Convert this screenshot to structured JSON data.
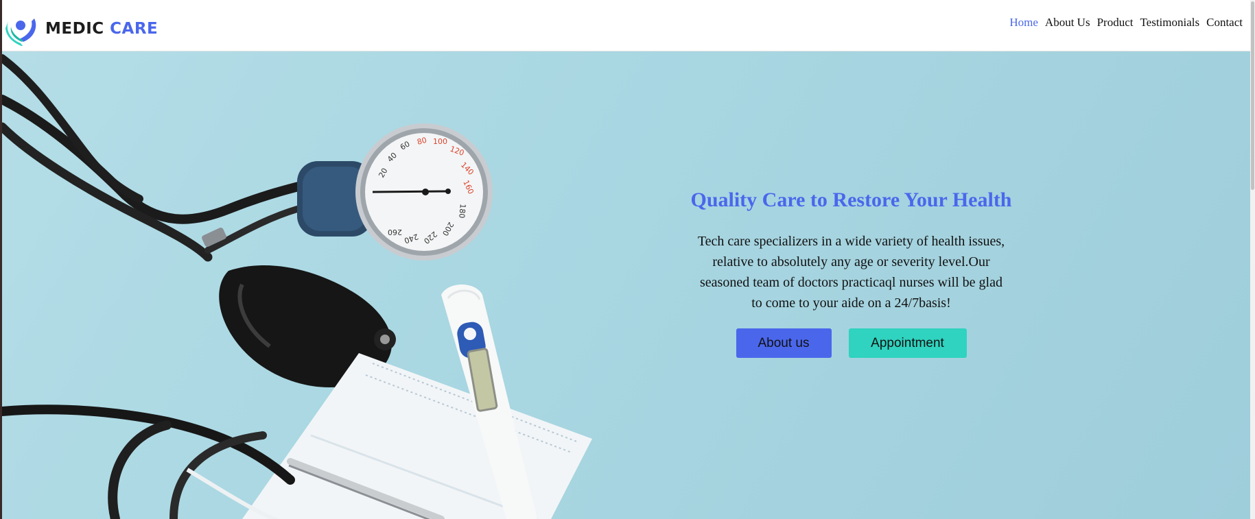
{
  "brand": {
    "name_part1": "MEDIC",
    "name_part2": "CARE",
    "logo_icon": "caring-hands-person-icon",
    "colors": {
      "primary": "#4a67ec",
      "accent": "#2fd3bf"
    }
  },
  "nav": {
    "items": [
      {
        "label": "Home",
        "active": true
      },
      {
        "label": "About Us",
        "active": false
      },
      {
        "label": "Product",
        "active": false
      },
      {
        "label": "Testimonials",
        "active": false
      },
      {
        "label": "Contact",
        "active": false
      }
    ]
  },
  "hero": {
    "title": "Quality Care to Restore Your Health",
    "description": "Tech care specializers in a wide variety of health issues, relative to absolutely any age or severity level.Our seasoned team of doctors practicaql nurses will be glad to come to your aide on a 24/7basis!",
    "buttons": {
      "about": "About us",
      "appointment": "Appointment"
    },
    "image": {
      "subject": "stethoscope-blood-pressure-gauge-thermometer-mask",
      "gauge_ticks": [
        "20",
        "40",
        "60",
        "80",
        "100",
        "120",
        "140",
        "160",
        "180",
        "200",
        "220",
        "240",
        "260"
      ]
    }
  }
}
